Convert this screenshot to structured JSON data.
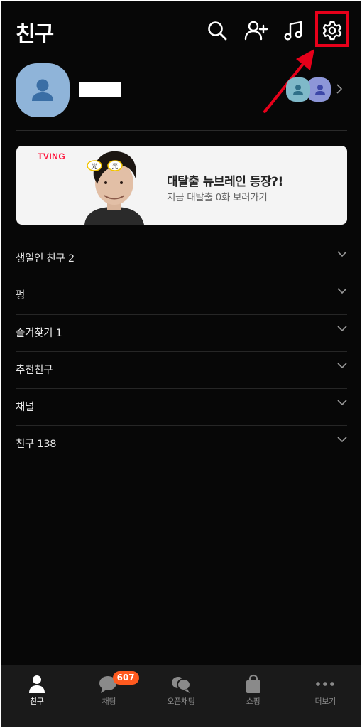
{
  "header": {
    "title": "친구",
    "icons": [
      "search-icon",
      "add-friend-icon",
      "music-icon",
      "settings-icon"
    ]
  },
  "banner": {
    "logo": "TVING",
    "title": "대탈출 뉴브레인 등장?!",
    "subtitle": "지금 대탈출 0화 보러가기",
    "sticker_text": "光"
  },
  "list": [
    {
      "label": "생일인 친구 2"
    },
    {
      "label": "펑"
    },
    {
      "label": "즐겨찾기 1"
    },
    {
      "label": "추천친구"
    },
    {
      "label": "채널"
    },
    {
      "label": "친구 138"
    }
  ],
  "bottom_nav": {
    "items": [
      {
        "label": "친구",
        "icon": "person-icon",
        "active": true
      },
      {
        "label": "채팅",
        "icon": "chat-bubble-icon",
        "badge": "607"
      },
      {
        "label": "오픈채팅",
        "icon": "open-chat-icon"
      },
      {
        "label": "쇼핑",
        "icon": "shopping-bag-icon"
      },
      {
        "label": "더보기",
        "icon": "more-dots-icon"
      }
    ]
  },
  "colors": {
    "background": "#070707",
    "highlight": "#e6001a",
    "badge": "#ff5a1f",
    "tving": "#ff153c"
  }
}
